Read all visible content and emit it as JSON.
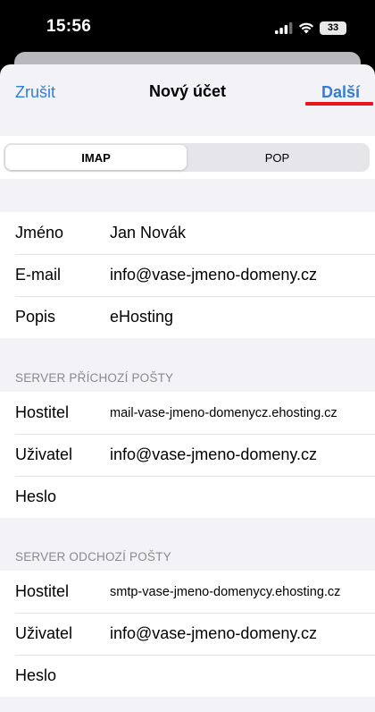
{
  "status": {
    "time": "15:56",
    "battery": "33"
  },
  "nav": {
    "cancel": "Zrušit",
    "title": "Nový účet",
    "next": "Další"
  },
  "segments": [
    {
      "label": "IMAP",
      "selected": true
    },
    {
      "label": "POP",
      "selected": false
    }
  ],
  "account": {
    "name_label": "Jméno",
    "name_value": "Jan Novák",
    "email_label": "E-mail",
    "email_value": "info@vase-jmeno-domeny.cz",
    "desc_label": "Popis",
    "desc_value": "eHosting"
  },
  "incoming": {
    "header": "SERVER PŘÍCHOZÍ POŠTY",
    "host_label": "Hostitel",
    "host_value": "mail-vase-jmeno-domenycz.ehosting.cz",
    "user_label": "Uživatel",
    "user_value": "info@vase-jmeno-domeny.cz",
    "pass_label": "Heslo",
    "pass_value": ""
  },
  "outgoing": {
    "header": "SERVER ODCHOZÍ POŠTY",
    "host_label": "Hostitel",
    "host_value": "smtp-vase-jmeno-domenycy.ehosting.cz",
    "user_label": "Uživatel",
    "user_value": "info@vase-jmeno-domeny.cz",
    "pass_label": "Heslo",
    "pass_value": ""
  },
  "colors": {
    "accent": "#2f7fd9",
    "highlight": "#e8151c",
    "background": "#f2f2f7"
  }
}
